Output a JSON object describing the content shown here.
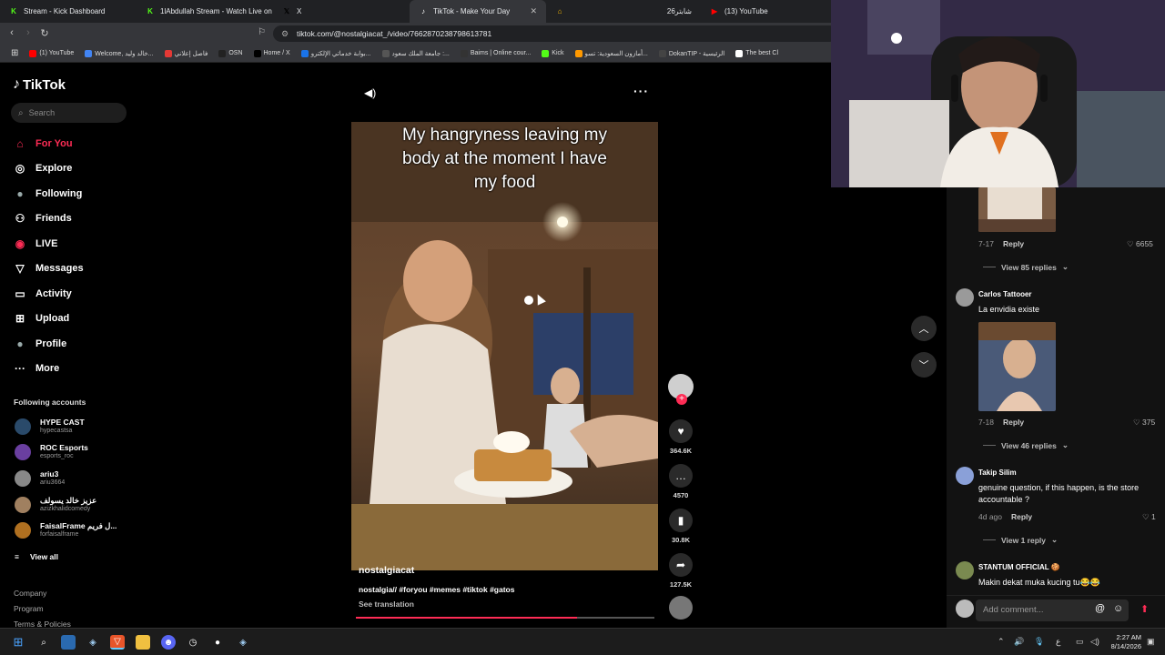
{
  "browser": {
    "tabs": [
      {
        "title": "Stream - Kick Dashboard",
        "icon": "kick-icon",
        "color": "#53fc18",
        "fav": "K"
      },
      {
        "title": "1lAbdullah Stream - Watch Live on Ki",
        "icon": "kick-icon",
        "color": "#53fc18",
        "fav": "K"
      },
      {
        "title": "X",
        "icon": "x-icon",
        "color": "#000000",
        "fav": "𝕏"
      },
      {
        "title": "TikTok - Make Your Day",
        "icon": "tiktok-icon",
        "color": "#ffffff",
        "fav": "♪",
        "active": true
      },
      {
        "title": "",
        "icon": "home-icon",
        "color": "#f4b400",
        "fav": "⌂"
      },
      {
        "title": "شابتر26",
        "icon": "",
        "color": "",
        "fav": ""
      },
      {
        "title": "(13) YouTube",
        "icon": "youtube-icon",
        "color": "#ff0000",
        "fav": "▶"
      }
    ],
    "url": "tiktok.com/@nostalgiacat_/video/7662870238798613781",
    "bookmarks": [
      {
        "label": "(1) YouTube",
        "color": "#ff0000"
      },
      {
        "label": "Welcome, خالد وليد...",
        "color": "#4285f4"
      },
      {
        "label": "فاصل إعلاني",
        "color": "#e53935"
      },
      {
        "label": "OSN",
        "color": "#222222"
      },
      {
        "label": "Home / X",
        "color": "#000000"
      },
      {
        "label": "بوابة خدماتي الإلكترو...",
        "color": "#1a73e8"
      },
      {
        "label": "جامعة الملك سعود :...",
        "color": "#555555"
      },
      {
        "label": "Baims | Online cour...",
        "color": "#333333"
      },
      {
        "label": "Kick",
        "color": "#53fc18"
      },
      {
        "label": "أمازون السعودية: تسو...",
        "color": "#ff9900"
      },
      {
        "label": "DokanTIP - الرئيسية",
        "color": "#444444"
      },
      {
        "label": "The best Cl",
        "color": "#ffffff"
      }
    ]
  },
  "tiktok": {
    "logo": "TikTok",
    "search_placeholder": "Search",
    "nav": [
      {
        "label": "For You",
        "icon": "home-icon",
        "glyph": "⌂",
        "active": true
      },
      {
        "label": "Explore",
        "icon": "compass-icon",
        "glyph": "◎"
      },
      {
        "label": "Following",
        "icon": "following-icon",
        "glyph": "●"
      },
      {
        "label": "Friends",
        "icon": "friends-icon",
        "glyph": "⚇"
      },
      {
        "label": "LIVE",
        "icon": "live-icon",
        "glyph": "◉"
      },
      {
        "label": "Messages",
        "icon": "messages-icon",
        "glyph": "▽"
      },
      {
        "label": "Activity",
        "icon": "activity-icon",
        "glyph": "▭"
      },
      {
        "label": "Upload",
        "icon": "upload-icon",
        "glyph": "⊞"
      },
      {
        "label": "Profile",
        "icon": "profile-icon",
        "glyph": "●"
      },
      {
        "label": "More",
        "icon": "more-icon",
        "glyph": "···"
      }
    ],
    "following_accounts_label": "Following accounts",
    "accounts": [
      {
        "name": "HYPE CAST",
        "handle": "hypecastsa",
        "color": "#2a4a6a"
      },
      {
        "name": "ROC Esports",
        "handle": "esports_roc",
        "color": "#6a3fa0"
      },
      {
        "name": "ariu3",
        "handle": "ariu3664",
        "color": "#888888"
      },
      {
        "name": "عزيز خالد يسولف",
        "handle": "azizkhalidcomedy",
        "color": "#a08060"
      },
      {
        "name": "FaisalFrame ل فريم...",
        "handle": "forfaisalframe",
        "color": "#b07020"
      }
    ],
    "view_all": "View all",
    "footer": [
      "Company",
      "Program",
      "Terms & Policies"
    ]
  },
  "video": {
    "caption": [
      "My hangryness leaving my",
      "body at the moment I have",
      "my food"
    ],
    "author": "nostalgiacat",
    "description": "nostalgia// #foryou #memes #tiktok #gatos",
    "see_translation": "See translation",
    "progress": 0.74,
    "likes": "364.6K",
    "comments": "4570",
    "saves": "30.8K",
    "shares": "127.5K"
  },
  "comments": {
    "items": [
      {
        "meta": "7-17",
        "reply": "Reply",
        "likes": "6655",
        "view_replies": "View 85 replies"
      },
      {
        "name": "Carlos Tattooer",
        "text": "La envidia existe",
        "meta": "7-18",
        "reply": "Reply",
        "likes": "375",
        "view_replies": "View 46 replies"
      },
      {
        "name": "Takip Silim",
        "text": "genuine question, if this happen, is the store accountable ?",
        "meta": "4d ago",
        "reply": "Reply",
        "likes": "1",
        "view_replies": "View 1 reply"
      },
      {
        "name": "STANTUM OFFICIAL 🍪",
        "text": "Makin dekat muka kucing tu😂😂"
      }
    ],
    "input_placeholder": "Add comment..."
  },
  "taskbar": {
    "time": "2:27 AM",
    "date": "8/14/2026",
    "lang": "ع"
  }
}
